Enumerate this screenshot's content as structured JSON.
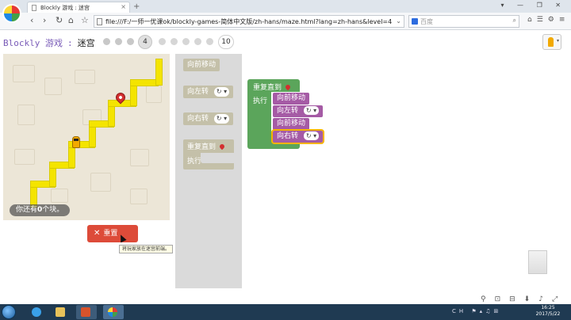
{
  "browser": {
    "tab_title": "Blockly 游戏 : 迷宫",
    "url": "file:///F:/一师一优课ok/blockly-games-简体中文版/zh-hans/maze.html?lang=zh-hans&level=4",
    "search_placeholder": "百度"
  },
  "header": {
    "app_name": "Blockly 游戏",
    "separator": ":",
    "level_title": "迷宫",
    "current_level": "4",
    "last_level": "10"
  },
  "maze": {
    "capacity_prefix": "你还有",
    "capacity_count": "0",
    "capacity_suffix": "个块。"
  },
  "reset_button": {
    "label": "重置"
  },
  "tooltip": "将玩家放在迷宫前端。",
  "toolbox": {
    "move_forward": "向前移动",
    "turn_left": "向左转",
    "turn_right": "向右转",
    "turn_symbol": "↻",
    "repeat_until": "重复直到",
    "do": "执行"
  },
  "workspace": {
    "repeat_until": "重复直到",
    "do": "执行",
    "blocks": [
      "向前移动",
      "向左转",
      "向前移动",
      "向右转"
    ],
    "turn_symbol": "↻"
  },
  "taskbar": {
    "time": "16:25",
    "date": "2017/5/22",
    "lang": "CH"
  },
  "colors": {
    "movement_block": "#a55ba5",
    "loop_block": "#5ba55b",
    "path": "#f4e400",
    "reset_button": "#dd4b39"
  }
}
